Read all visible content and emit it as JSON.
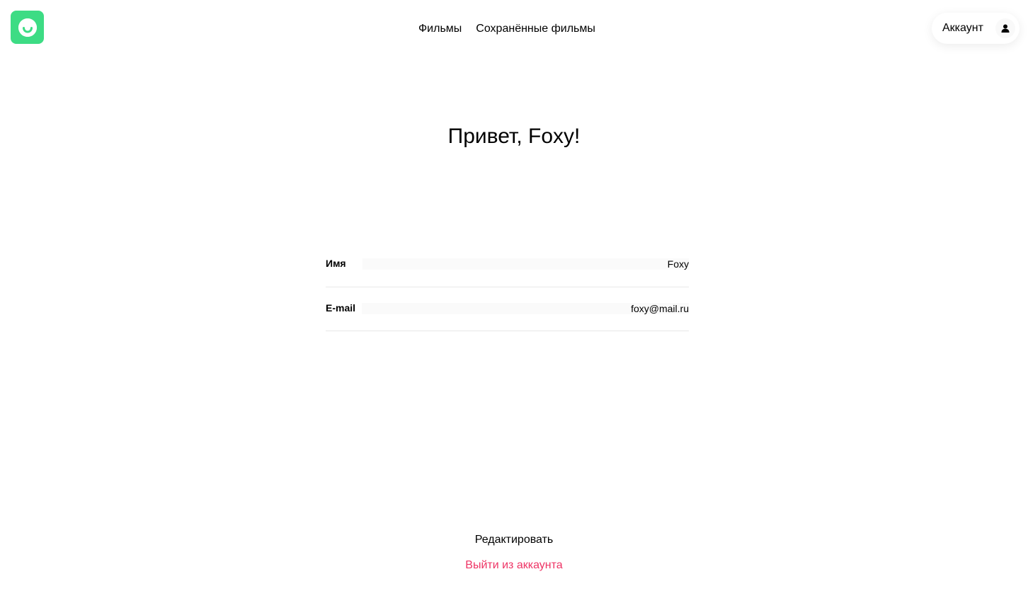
{
  "header": {
    "logo_icon": "smile-icon",
    "nav": [
      {
        "label": "Фильмы"
      },
      {
        "label": "Сохранённые фильмы"
      }
    ],
    "account_label": "Аккаунт",
    "account_icon": "user-icon"
  },
  "profile": {
    "greeting": "Привет, Foxy!",
    "fields": [
      {
        "label": "Имя",
        "value": "Foxy"
      },
      {
        "label": "E-mail",
        "value": "foxy@mail.ru"
      }
    ]
  },
  "actions": {
    "edit_label": "Редактировать",
    "logout_label": "Выйти из аккаунта"
  },
  "colors": {
    "brand": "#3ddc84",
    "logout": "#ee3465",
    "divider": "#e8e8e8"
  }
}
